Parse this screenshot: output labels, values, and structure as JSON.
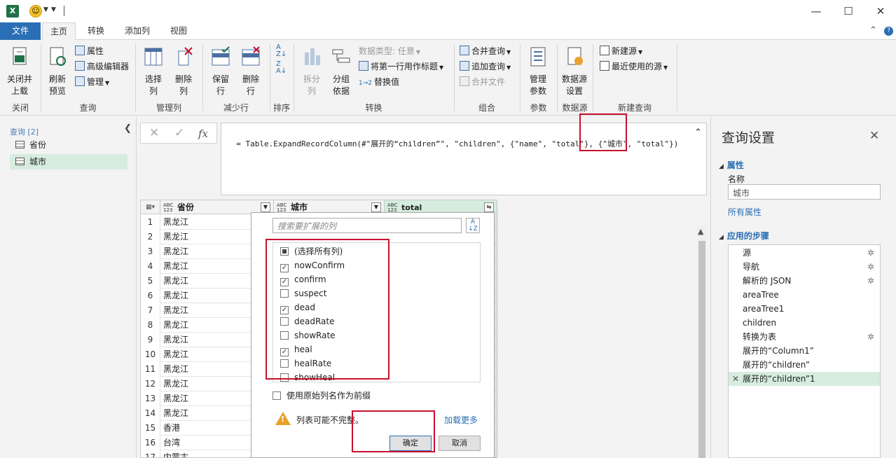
{
  "titlebar": {
    "app_logo": "X",
    "smiley": "☺",
    "minimize": "—",
    "maximize": "☐",
    "close": "✕"
  },
  "tabs": [
    {
      "label": "文件"
    },
    {
      "label": "主页"
    },
    {
      "label": "转换"
    },
    {
      "label": "添加列"
    },
    {
      "label": "视图"
    }
  ],
  "ribbon": {
    "close_group": {
      "label": "关闭",
      "close_load": "关闭并\n上载"
    },
    "query_group": {
      "label": "查询",
      "refresh": "刷新\n预览",
      "properties": "属性",
      "advanced_editor": "高级编辑器",
      "manage": "管理"
    },
    "manage_cols_group": {
      "label": "管理列",
      "choose_cols": "选择\n列",
      "remove_cols": "删除\n列"
    },
    "reduce_rows_group": {
      "label": "减少行",
      "keep_rows": "保留\n行",
      "remove_rows": "删除\n行"
    },
    "sort_group": {
      "label": "排序"
    },
    "transform_group": {
      "label": "转换",
      "split_col": "拆分\n列",
      "group_by": "分组\n依据",
      "data_type": "数据类型: 任意",
      "first_row_header": "将第一行用作标题",
      "replace_values": "替换值"
    },
    "combine_group": {
      "label": "组合",
      "merge_queries": "合并查询",
      "append_queries": "追加查询",
      "combine_files": "合并文件"
    },
    "params_group": {
      "label": "参数",
      "manage_params": "管理\n参数"
    },
    "datasource_group": {
      "label": "数据源",
      "ds_settings": "数据源\n设置"
    },
    "new_query_group": {
      "label": "新建查询",
      "new_source": "新建源",
      "recent_sources": "最近使用的源"
    }
  },
  "queries": {
    "header": "查询 [2]",
    "items": [
      {
        "label": "省份"
      },
      {
        "label": "城市"
      }
    ]
  },
  "formula": {
    "cancel": "✕",
    "confirm": "✓",
    "fx": "fx",
    "text": "= Table.ExpandRecordColumn(#\"展开的“children”\", \"children\", {\"name\", \"total\"}, {\"城市\", \"total\"})"
  },
  "grid": {
    "columns": [
      {
        "type": "ABC\n123",
        "name": "省份"
      },
      {
        "type": "ABC\n123",
        "name": "城市"
      },
      {
        "type": "ABC\n123",
        "name": "total"
      }
    ],
    "rows": [
      {
        "n": "1",
        "v": "黑龙江"
      },
      {
        "n": "2",
        "v": "黑龙江"
      },
      {
        "n": "3",
        "v": "黑龙江"
      },
      {
        "n": "4",
        "v": "黑龙江"
      },
      {
        "n": "5",
        "v": "黑龙江"
      },
      {
        "n": "6",
        "v": "黑龙江"
      },
      {
        "n": "7",
        "v": "黑龙江"
      },
      {
        "n": "8",
        "v": "黑龙江"
      },
      {
        "n": "9",
        "v": "黑龙江"
      },
      {
        "n": "10",
        "v": "黑龙江"
      },
      {
        "n": "11",
        "v": "黑龙江"
      },
      {
        "n": "12",
        "v": "黑龙江"
      },
      {
        "n": "13",
        "v": "黑龙江"
      },
      {
        "n": "14",
        "v": "黑龙江"
      },
      {
        "n": "15",
        "v": "香港"
      },
      {
        "n": "16",
        "v": "台湾"
      },
      {
        "n": "17",
        "v": "内蒙古"
      }
    ]
  },
  "expand_popup": {
    "search_placeholder": "搜索要扩展的列",
    "sort_icon": "A↓Z",
    "items": [
      {
        "label": "(选择所有列)",
        "state": "partial"
      },
      {
        "label": "nowConfirm",
        "state": "checked"
      },
      {
        "label": "confirm",
        "state": "checked"
      },
      {
        "label": "suspect",
        "state": "unchecked"
      },
      {
        "label": "dead",
        "state": "checked"
      },
      {
        "label": "deadRate",
        "state": "unchecked"
      },
      {
        "label": "showRate",
        "state": "unchecked"
      },
      {
        "label": "heal",
        "state": "checked"
      },
      {
        "label": "healRate",
        "state": "unchecked"
      },
      {
        "label": "showHeal",
        "state": "unchecked"
      }
    ],
    "use_prefix": "使用原始列名作为前缀",
    "warning": "列表可能不完整。",
    "load_more": "加载更多",
    "ok": "确定",
    "cancel": "取消"
  },
  "settings": {
    "title": "查询设置",
    "props_section": "属性",
    "name_label": "名称",
    "name_value": "城市",
    "all_props": "所有属性",
    "steps_section": "应用的步骤",
    "steps": [
      {
        "label": "源",
        "gear": true
      },
      {
        "label": "导航",
        "gear": true
      },
      {
        "label": "解析的 JSON",
        "gear": true
      },
      {
        "label": "areaTree",
        "gear": false
      },
      {
        "label": "areaTree1",
        "gear": false
      },
      {
        "label": "children",
        "gear": false
      },
      {
        "label": "转换为表",
        "gear": true
      },
      {
        "label": "展开的“Column1”",
        "gear": false
      },
      {
        "label": "展开的“children”",
        "gear": false
      },
      {
        "label": "展开的“children”1",
        "gear": false,
        "selected": true
      }
    ]
  },
  "colors": {
    "accent_blue": "#2a6fb5",
    "highlight_red": "#c8102e",
    "selection_green": "#d6ecdf",
    "excel_green": "#1f7246"
  }
}
